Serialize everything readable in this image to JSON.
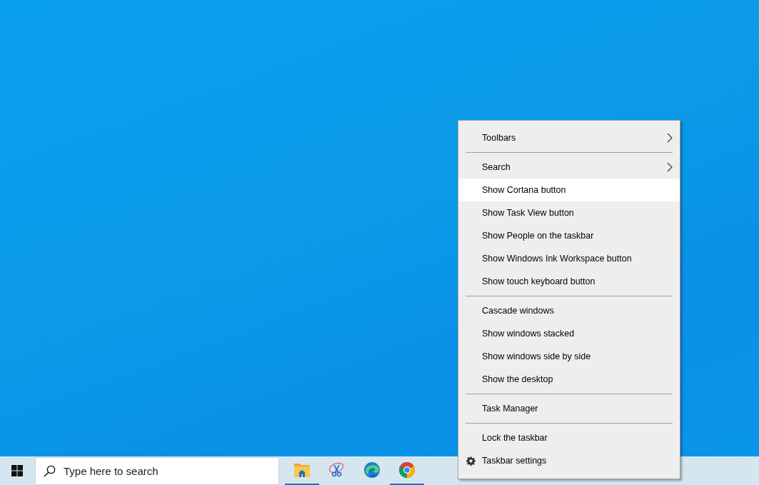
{
  "context_menu": {
    "items": [
      {
        "kind": "submenu",
        "label": "Toolbars",
        "selected": false
      },
      {
        "kind": "separator"
      },
      {
        "kind": "submenu",
        "label": "Search",
        "selected": false
      },
      {
        "kind": "item",
        "label": "Show Cortana button",
        "selected": true
      },
      {
        "kind": "item",
        "label": "Show Task View button",
        "selected": false
      },
      {
        "kind": "item",
        "label": "Show People on the taskbar",
        "selected": false
      },
      {
        "kind": "item",
        "label": "Show Windows Ink Workspace button",
        "selected": false
      },
      {
        "kind": "item",
        "label": "Show touch keyboard button",
        "selected": false
      },
      {
        "kind": "separator"
      },
      {
        "kind": "item",
        "label": "Cascade windows",
        "selected": false
      },
      {
        "kind": "item",
        "label": "Show windows stacked",
        "selected": false
      },
      {
        "kind": "item",
        "label": "Show windows side by side",
        "selected": false
      },
      {
        "kind": "item",
        "label": "Show the desktop",
        "selected": false
      },
      {
        "kind": "separator"
      },
      {
        "kind": "item",
        "label": "Task Manager",
        "selected": false
      },
      {
        "kind": "separator"
      },
      {
        "kind": "item",
        "label": "Lock the taskbar",
        "selected": false
      },
      {
        "kind": "settings",
        "label": "Taskbar settings",
        "selected": false
      }
    ]
  },
  "taskbar": {
    "search": {
      "placeholder": "Type here to search"
    },
    "apps": [
      {
        "kind": "folder",
        "running": true
      },
      {
        "kind": "snip",
        "running": false
      },
      {
        "kind": "edge",
        "running": false
      },
      {
        "kind": "chrome",
        "running": true
      }
    ]
  }
}
